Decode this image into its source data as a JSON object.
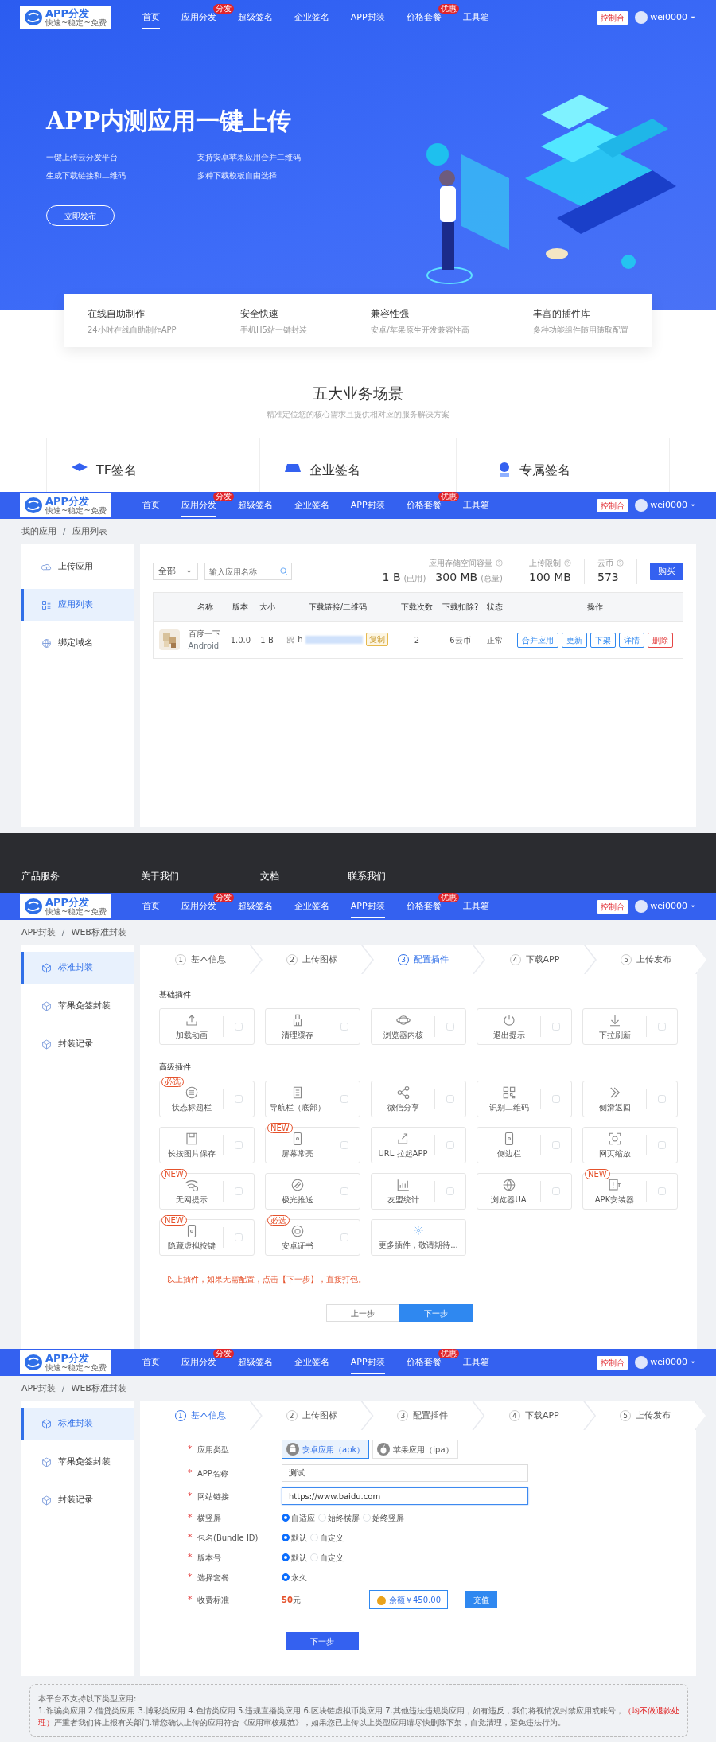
{
  "landing": {
    "navbar": {
      "kind": "transparent",
      "logo": {
        "name": "APP分发",
        "slogan": "快速~稳定~免费"
      },
      "items": [
        {
          "label": "首页",
          "selected": true
        },
        {
          "label": "应用分发",
          "selected": false,
          "badge": "分发"
        },
        {
          "label": "超级签名",
          "selected": false
        },
        {
          "label": "企业签名",
          "selected": false
        },
        {
          "label": "APP封装",
          "selected": false
        },
        {
          "label": "价格套餐",
          "selected": false,
          "badge": "优惠"
        },
        {
          "label": "工具箱",
          "selected": false
        }
      ],
      "console_button": "控制台",
      "user": "wei0000"
    },
    "hero": {
      "title": "APP内测应用一键上传",
      "points": [
        "一键上传云分发平台",
        "支持安卓苹果应用合并二维码",
        "生成下载链接和二维码",
        "多种下载模板自由选择"
      ],
      "button": "立即发布"
    },
    "features": [
      {
        "title": "在线自助制作",
        "desc": "24小时在线自助制作APP"
      },
      {
        "title": "安全快速",
        "desc": "手机H5站一键封装"
      },
      {
        "title": "兼容性强",
        "desc": "安卓/苹果原生开发兼容性高"
      },
      {
        "title": "丰富的插件库",
        "desc": "多种功能组件随用随取配置"
      }
    ],
    "scenarios": {
      "title": "五大业务场景",
      "subtitle": "精准定位您的核心需求且提供相对应的服务解决方案",
      "cards": [
        {
          "title": "TF签名"
        },
        {
          "title": "企业签名"
        },
        {
          "title": "专属签名"
        }
      ]
    }
  },
  "app_list": {
    "navbar": {
      "kind": "solid",
      "logo": {
        "name": "APP分发",
        "slogan": "快速~稳定~免费"
      },
      "items": [
        {
          "label": "首页",
          "selected": false
        },
        {
          "label": "应用分发",
          "selected": true,
          "badge": "分发"
        },
        {
          "label": "超级签名",
          "selected": false
        },
        {
          "label": "企业签名",
          "selected": false
        },
        {
          "label": "APP封装",
          "selected": false
        },
        {
          "label": "价格套餐",
          "selected": false,
          "badge": "优惠"
        },
        {
          "label": "工具箱",
          "selected": false
        }
      ],
      "console_button": "控制台",
      "user": "wei0000"
    },
    "breadcrumb": {
      "items": [
        "我的应用",
        "应用列表"
      ],
      "separator": "/"
    },
    "sidebar": [
      {
        "label": "上传应用",
        "selected": false
      },
      {
        "label": "应用列表",
        "selected": true
      },
      {
        "label": "绑定域名",
        "selected": false
      }
    ],
    "filter": {
      "value": "全部"
    },
    "search": {
      "placeholder": "输入应用名称"
    },
    "storage": {
      "label": "应用存储空间容量",
      "used": "1 B",
      "used_note": "(已用)",
      "total": "300 MB",
      "total_note": "(总量)"
    },
    "upload_limit": {
      "label": "上传限制",
      "value": "100 MB"
    },
    "coins": {
      "label": "云币",
      "value": "573"
    },
    "buy_button": "购买",
    "table": {
      "columns": [
        "名称",
        "版本",
        "大小",
        "下载链接/二维码",
        "下载次数",
        "下载扣除?",
        "状态",
        "操作"
      ],
      "rows": [
        {
          "name": "百度一下",
          "platform": "Android",
          "version": "1.0.0",
          "size": "1 B",
          "link": "h",
          "copy": "复制",
          "downloads": "2",
          "cost": "6云币",
          "status": "正常",
          "actions": [
            {
              "label": "合并应用",
              "kind": "normal"
            },
            {
              "label": "更新",
              "kind": "normal"
            },
            {
              "label": "下架",
              "kind": "normal"
            },
            {
              "label": "详情",
              "kind": "normal"
            },
            {
              "label": "删除",
              "kind": "danger"
            }
          ]
        }
      ]
    }
  },
  "footer": {
    "headings": [
      "产品服务",
      "关于我们",
      "文档",
      "联系我们"
    ]
  },
  "plugin_config": {
    "navbar": {
      "kind": "solid",
      "logo": {
        "name": "APP分发",
        "slogan": "快速~稳定~免费"
      },
      "items": [
        {
          "label": "首页",
          "selected": false
        },
        {
          "label": "应用分发",
          "selected": false,
          "badge": "分发"
        },
        {
          "label": "超级签名",
          "selected": false
        },
        {
          "label": "企业签名",
          "selected": false
        },
        {
          "label": "APP封装",
          "selected": true
        },
        {
          "label": "价格套餐",
          "selected": false,
          "badge": "优惠"
        },
        {
          "label": "工具箱",
          "selected": false
        }
      ],
      "console_button": "控制台",
      "user": "wei0000"
    },
    "breadcrumb": {
      "items": [
        "APP封装",
        "WEB标准封装"
      ],
      "separator": "/"
    },
    "sidebar": [
      {
        "label": "标准封装",
        "selected": true
      },
      {
        "label": "苹果免签封装",
        "selected": false
      },
      {
        "label": "封装记录",
        "selected": false
      }
    ],
    "steps": [
      {
        "number": "1",
        "label": "基本信息",
        "selected": false
      },
      {
        "number": "2",
        "label": "上传图标",
        "selected": false
      },
      {
        "number": "3",
        "label": "配置插件",
        "selected": true
      },
      {
        "number": "4",
        "label": "下载APP",
        "selected": false
      },
      {
        "number": "5",
        "label": "上传发布",
        "selected": false
      }
    ],
    "basic": {
      "title": "基础插件",
      "plugins": [
        {
          "kind": "plugin",
          "label": "加载动画",
          "checked": false
        },
        {
          "kind": "plugin",
          "label": "清理缓存",
          "checked": false
        },
        {
          "kind": "plugin",
          "label": "浏览器内核",
          "checked": false
        },
        {
          "kind": "plugin",
          "label": "退出提示",
          "checked": false
        },
        {
          "kind": "plugin",
          "label": "下拉刷新",
          "checked": false
        }
      ]
    },
    "advanced": {
      "title": "高级插件",
      "plugins": [
        {
          "kind": "plugin",
          "label": "状态标题栏",
          "checked": false,
          "badge": "必选"
        },
        {
          "kind": "plugin",
          "label": "导航栏（底部）",
          "checked": false
        },
        {
          "kind": "plugin",
          "label": "微信分享",
          "checked": false
        },
        {
          "kind": "plugin",
          "label": "识别二维码",
          "checked": false
        },
        {
          "kind": "plugin",
          "label": "侧滑返回",
          "checked": false
        },
        {
          "kind": "plugin",
          "label": "长按图片保存",
          "checked": false
        },
        {
          "kind": "plugin",
          "label": "屏幕常亮",
          "checked": false,
          "badge": "NEW"
        },
        {
          "kind": "plugin",
          "label": "URL 拉起APP",
          "checked": false
        },
        {
          "kind": "plugin",
          "label": "侧边栏",
          "checked": false
        },
        {
          "kind": "plugin",
          "label": "网页缩放",
          "checked": false
        },
        {
          "kind": "plugin",
          "label": "无网提示",
          "checked": false,
          "badge": "NEW"
        },
        {
          "kind": "plugin",
          "label": "极光推送",
          "checked": false
        },
        {
          "kind": "plugin",
          "label": "友盟统计",
          "checked": false
        },
        {
          "kind": "plugin",
          "label": "浏览器UA",
          "checked": false
        },
        {
          "kind": "plugin",
          "label": "APK安装器",
          "checked": false,
          "badge": "NEW"
        },
        {
          "kind": "plugin",
          "label": "隐藏虚拟按键",
          "checked": false,
          "badge": "NEW"
        },
        {
          "kind": "plugin",
          "label": "安卓证书",
          "checked": false,
          "badge": "必选"
        },
        {
          "kind": "more",
          "label": "更多插件，敬请期待..."
        }
      ]
    },
    "note": "以上插件，如果无需配置，点击【下一步】，直接打包。",
    "prev_button": "上一步",
    "next_button": "下一步"
  },
  "app_form": {
    "navbar": {
      "kind": "solid",
      "logo": {
        "name": "APP分发",
        "slogan": "快速~稳定~免费"
      },
      "items": [
        {
          "label": "首页",
          "selected": false
        },
        {
          "label": "应用分发",
          "selected": false,
          "badge": "分发"
        },
        {
          "label": "超级签名",
          "selected": false
        },
        {
          "label": "企业签名",
          "selected": false
        },
        {
          "label": "APP封装",
          "selected": true
        },
        {
          "label": "价格套餐",
          "selected": false,
          "badge": "优惠"
        },
        {
          "label": "工具箱",
          "selected": false
        }
      ],
      "console_button": "控制台",
      "user": "wei0000"
    },
    "breadcrumb": {
      "items": [
        "APP封装",
        "WEB标准封装"
      ],
      "separator": "/"
    },
    "sidebar": [
      {
        "label": "标准封装",
        "selected": true
      },
      {
        "label": "苹果免签封装",
        "selected": false
      },
      {
        "label": "封装记录",
        "selected": false
      }
    ],
    "steps": [
      {
        "number": "1",
        "label": "基本信息",
        "selected": true
      },
      {
        "number": "2",
        "label": "上传图标",
        "selected": false
      },
      {
        "number": "3",
        "label": "配置插件",
        "selected": false
      },
      {
        "number": "4",
        "label": "下载APP",
        "selected": false
      },
      {
        "number": "5",
        "label": "上传发布",
        "selected": false
      }
    ],
    "fields": [
      {
        "mark": "*",
        "label": "应用类型",
        "kind": "choice",
        "options": [
          {
            "label": "安卓应用（apk）",
            "selected": true
          },
          {
            "label": "苹果应用（ipa）",
            "selected": false
          }
        ]
      },
      {
        "mark": "*",
        "label": "APP名称",
        "kind": "text",
        "value": "测试",
        "focused": false
      },
      {
        "mark": "*",
        "label": "网站链接",
        "kind": "text",
        "value": "https://www.baidu.com",
        "focused": true
      },
      {
        "mark": "*",
        "label": "横竖屏",
        "kind": "radio",
        "options": [
          {
            "label": "自适应",
            "selected": true
          },
          {
            "label": "始终横屏",
            "selected": false
          },
          {
            "label": "始终竖屏",
            "selected": false
          }
        ]
      },
      {
        "mark": "*",
        "label": "包名(Bundle ID)",
        "kind": "radio",
        "options": [
          {
            "label": "默认",
            "selected": true
          },
          {
            "label": "自定义",
            "selected": false
          }
        ]
      },
      {
        "mark": "*",
        "label": "版本号",
        "kind": "radio",
        "options": [
          {
            "label": "默认",
            "selected": true
          },
          {
            "label": "自定义",
            "selected": false
          }
        ]
      },
      {
        "mark": "*",
        "label": "选择套餐",
        "kind": "radio",
        "options": [
          {
            "label": "永久",
            "selected": true
          }
        ]
      },
      {
        "mark": "*",
        "label": "收费标准",
        "kind": "fee",
        "amount": "**50**元",
        "balance": "余额￥450.00",
        "recharge": "充值"
      }
    ],
    "submit": "下一步",
    "notice": {
      "title": "本平台不支持以下类型应用:",
      "parts": [
        {
          "kind": "plain",
          "text": "1.诈骗类应用 2.借贷类应用 3.博彩类应用 4.色情类应用 5.违规直播类应用 6.区块链虚拟币类应用 7.其他违法违规类应用，如有违反，我们将视情况封禁应用或账号，"
        },
        {
          "kind": "warning",
          "text": "（均不做退款处理）"
        },
        {
          "kind": "plain",
          "text": "严重者我们将上报有关部门.请您确认上传的应用符合"
        },
        {
          "kind": "link",
          "text": "《应用审核规范》"
        },
        {
          "kind": "plain",
          "text": "，如果您已上传以上类型应用请尽快删除下架，自觉清理，避免违法行为。"
        }
      ]
    }
  }
}
